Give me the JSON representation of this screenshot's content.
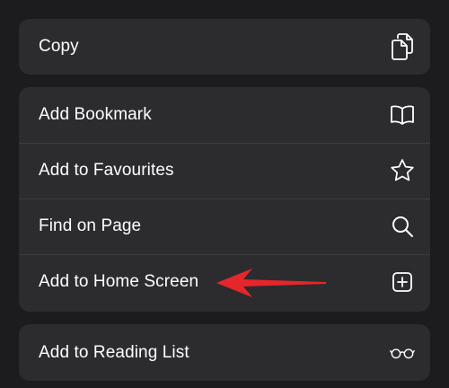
{
  "menu": {
    "group1": [
      {
        "label": "Copy",
        "icon": "copy-icon"
      }
    ],
    "group2": [
      {
        "label": "Add Bookmark",
        "icon": "book-icon"
      },
      {
        "label": "Add to Favourites",
        "icon": "star-icon"
      },
      {
        "label": "Find on Page",
        "icon": "search-icon"
      },
      {
        "label": "Add to Home Screen",
        "icon": "add-square-icon"
      }
    ],
    "group3": [
      {
        "label": "Add to Reading List",
        "icon": "glasses-icon"
      }
    ]
  },
  "colors": {
    "background": "#1c1c1e",
    "group": "#2c2c2e",
    "separator": "#3d3d41",
    "text": "#ffffff",
    "annotation_arrow": "#e5262b"
  }
}
